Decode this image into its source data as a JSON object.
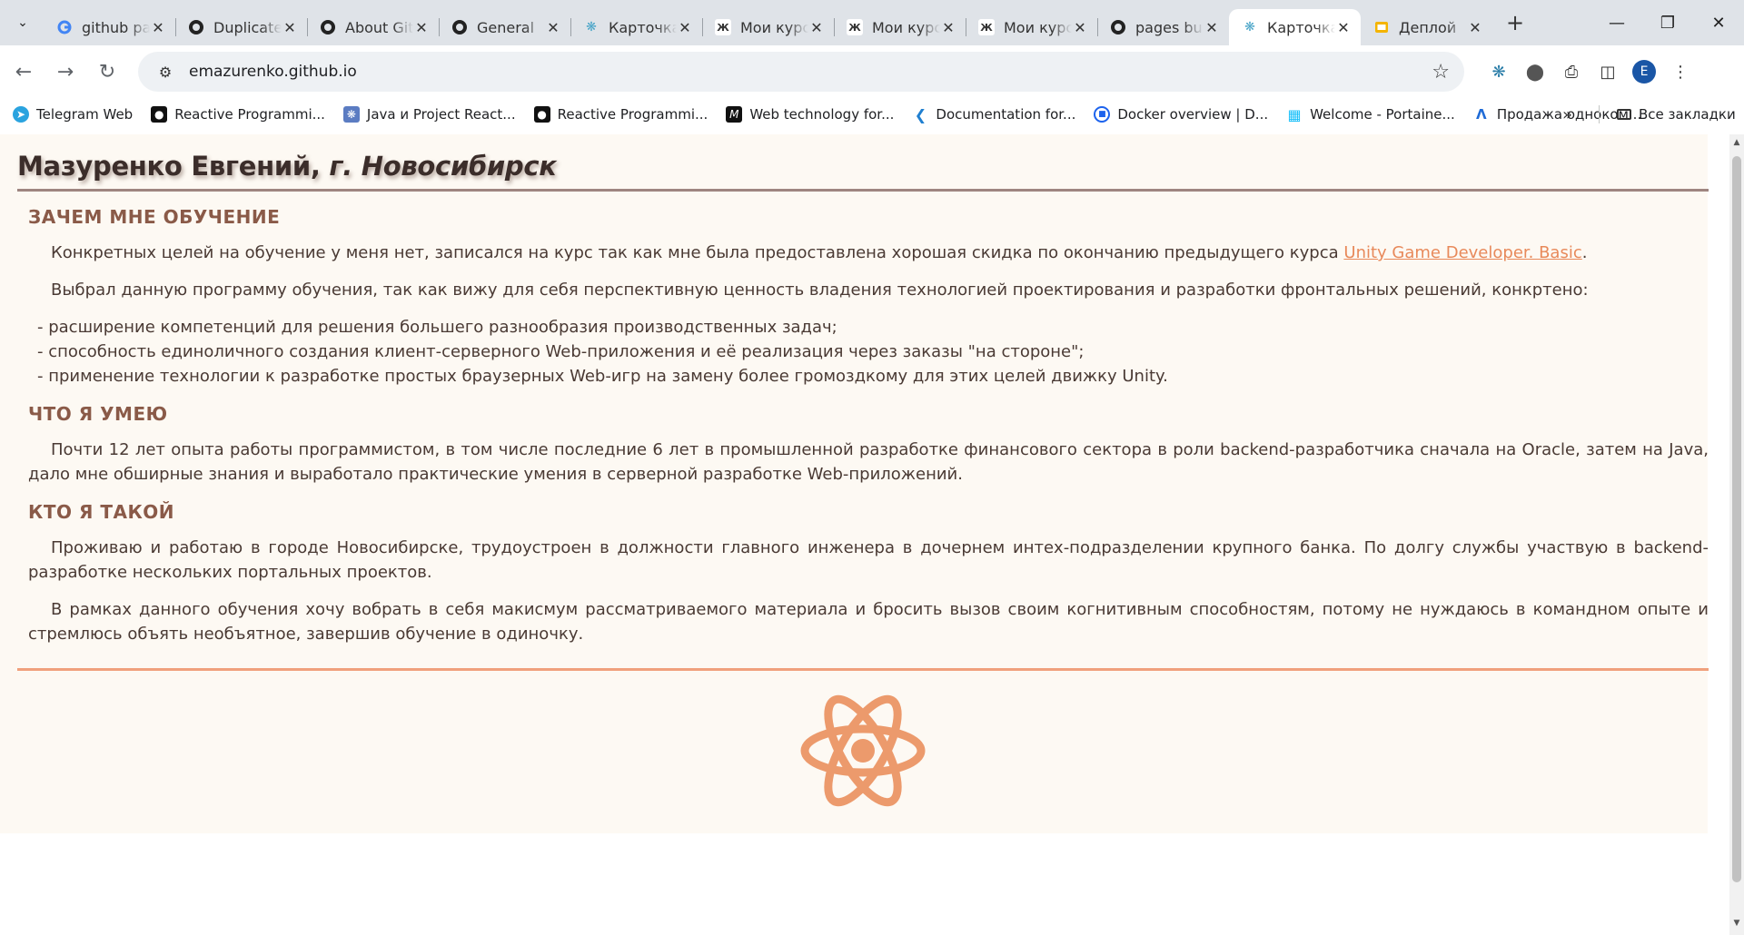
{
  "browser": {
    "tabs": [
      {
        "title": "github pages",
        "icon": "google-icon",
        "active": false
      },
      {
        "title": "Duplicate",
        "icon": "github-icon",
        "active": false
      },
      {
        "title": "About GitHub",
        "icon": "github-icon",
        "active": false
      },
      {
        "title": "General",
        "icon": "github-icon",
        "active": false
      },
      {
        "title": "Карточка",
        "icon": "react-icon",
        "active": false
      },
      {
        "title": "Мои курсы",
        "icon": "otus-icon",
        "active": false
      },
      {
        "title": "Мои курсы",
        "icon": "otus-icon",
        "active": false
      },
      {
        "title": "Мои курсы",
        "icon": "otus-icon",
        "active": false
      },
      {
        "title": "pages build",
        "icon": "github-icon",
        "active": false
      },
      {
        "title": "Карточка",
        "icon": "react-icon",
        "active": true
      },
      {
        "title": "Деплой",
        "icon": "slides-icon",
        "active": false
      }
    ],
    "close_glyph": "✕",
    "newtab_glyph": "+",
    "url": "emazurenko.github.io",
    "profile_letter": "E",
    "bookmarks": [
      {
        "label": "Telegram Web",
        "icon": "telegram-icon"
      },
      {
        "label": "Reactive Programmi...",
        "icon": "medium-icon"
      },
      {
        "label": "Java и Project React...",
        "icon": "spring-icon"
      },
      {
        "label": "Reactive Programmi...",
        "icon": "medium-icon"
      },
      {
        "label": "Web technology for...",
        "icon": "mdn-icon"
      },
      {
        "label": "Documentation for...",
        "icon": "vscode-icon"
      },
      {
        "label": "Docker overview | D...",
        "icon": "docker-icon"
      },
      {
        "label": "Welcome - Portaine...",
        "icon": "portainer-icon"
      },
      {
        "label": "Продажа одноком...",
        "icon": "avito-icon"
      }
    ],
    "all_bookmarks": "Все закладки"
  },
  "page": {
    "title_name": "Мазуренко Евгений,",
    "title_city": " г. Новосибирск",
    "sections": [
      {
        "heading": "ЗАЧЕМ МНЕ ОБУЧЕНИЕ",
        "p1_before": "Конкретных целей на обучение у меня нет, записался на курс так как мне была предоставлена хорошая скидка по окончанию предыдущего курса ",
        "p1_link": "Unity Game Developer. Basic",
        "p1_after": ".",
        "p2": "Выбрал данную программу обучения, так как вижу для себя перспективную ценность владения технологией проектирования и разработки фронтальных решений, конкртено:",
        "list": [
          "- расширение компетенций для решения большего разнообразия производственных задач;",
          "- способность единоличного создания клиент-серверного Web-приложения и её реализация через заказы \"на стороне\";",
          "- применение технологии к разработке простых браузерных Web-игр на замену более громоздкому для этих целей движку Unity."
        ]
      },
      {
        "heading": "ЧТО Я УМЕЮ",
        "p1": "Почти 12 лет опыта работы программистом, в том числе последние 6 лет в промышленной разработке финансового сектора в роли backend-разработчика сначала на Oracle, затем на Java, дало мне обширные знания и выработало практические умения в серверной разработке Web-приложений."
      },
      {
        "heading": "КТО Я ТАКОЙ",
        "p1": "Проживаю и работаю в городе Новосибирске, трудоустроен в должности главного инженера в дочернем интех-подразделении крупного банка. По долгу службы участвую в backend-разработке нескольких портальных проектов.",
        "p2": "В рамках данного обучения хочу вобрать в себя макисмум рассматриваемого материала и бросить вызов своим когнитивным способностям, потому не нуждаюсь в командном опыте и стремлюсь объять необъятное, завершив обучение в одиночку."
      }
    ],
    "colors": {
      "background": "#fdf9f3",
      "heading": "#8a5a48",
      "text": "#4a3a34",
      "accent": "#e8895a",
      "atom": "#ec9a6c"
    },
    "footer_icon": "react-atom-icon"
  }
}
